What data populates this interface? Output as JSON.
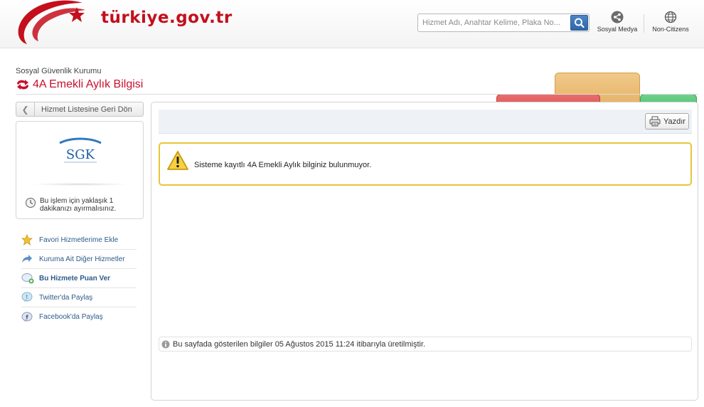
{
  "header": {
    "logo_text": "türkiye.gov.tr",
    "search_placeholder": "Hizmet Adı, Anahtar Kelime, Plaka No...",
    "social_label": "Sosyal Medya",
    "noncitizens_label": "Non-Citizens",
    "brand_color": "#c40f1c"
  },
  "service": {
    "institution": "Sosyal Güvenlik Kurumu",
    "title": "4A Emekli Aylık Bilgisi"
  },
  "sidebar": {
    "back_label": "Hizmet Listesine Geri Dön",
    "org_logo_text": "SGK",
    "time_note": "Bu işlem için yaklaşık 1 dakikanızı ayırmalısınız.",
    "actions": [
      {
        "label": "Favori Hizmetlerime Ekle",
        "icon": "star-icon"
      },
      {
        "label": "Kuruma Ait Diğer Hizmetler",
        "icon": "arrow-icon"
      },
      {
        "label": "Bu Hizmete Puan Ver",
        "icon": "rating-bubble-icon"
      },
      {
        "label": "Twitter'da Paylaş",
        "icon": "twitter-icon"
      },
      {
        "label": "Facebook'da Paylaş",
        "icon": "facebook-icon"
      }
    ]
  },
  "main": {
    "print_label": "Yazdır",
    "alert_text": "Sisteme kayıtlı 4A Emekli Aylık bilginiz bulunmuyor.",
    "footnote": "Bu sayfada gösterilen bilgiler 05 Ağustos 2015 11:24 itibarıyla üretilmiştir.",
    "alert_color": "#e8c53a"
  }
}
